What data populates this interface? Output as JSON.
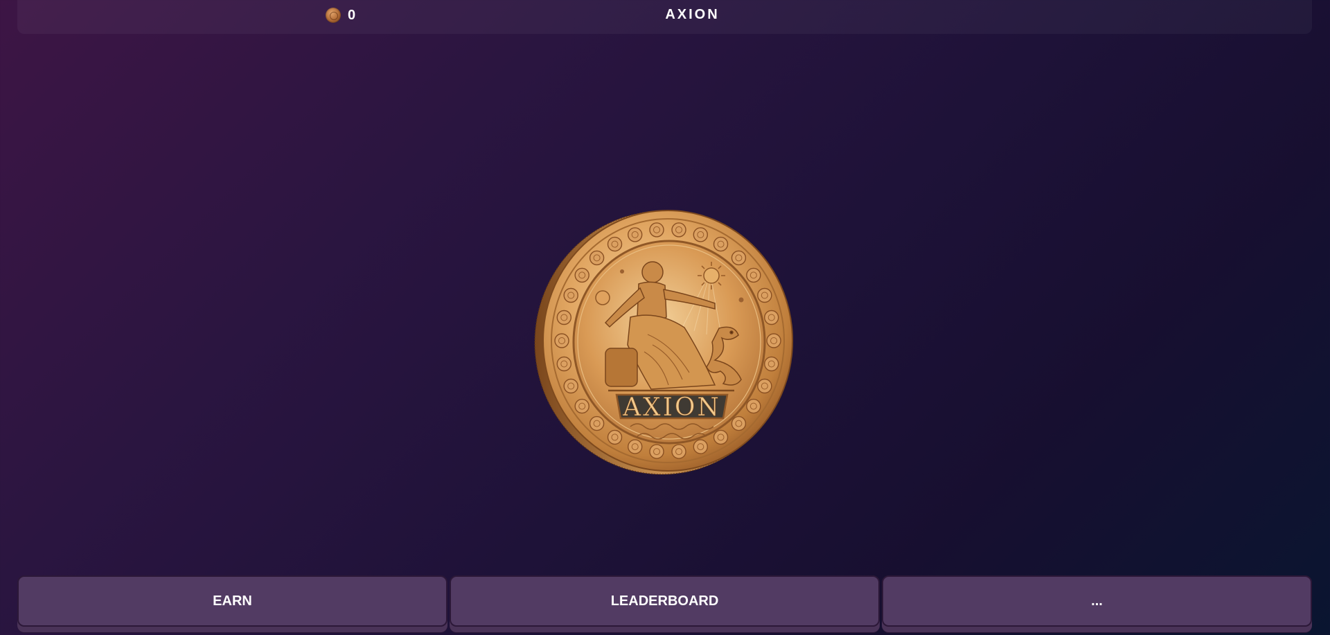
{
  "header": {
    "balance_icon": "coin-icon",
    "balance": "0",
    "title": "AXION"
  },
  "coin": {
    "icon": "axion-coin-icon",
    "inscription": "AXION",
    "colors": {
      "gold_light": "#f3c98a",
      "gold_mid": "#d89a55",
      "gold_dark": "#9a5a26",
      "banner": "#3f3a33"
    }
  },
  "nav": {
    "items": [
      {
        "label": "EARN"
      },
      {
        "label": "LEADERBOARD"
      },
      {
        "label": "..."
      }
    ]
  },
  "colors": {
    "background_start": "#3d1545",
    "background_end": "#0a1530",
    "button_bg": "#523b63",
    "button_border": "#2c1838"
  }
}
